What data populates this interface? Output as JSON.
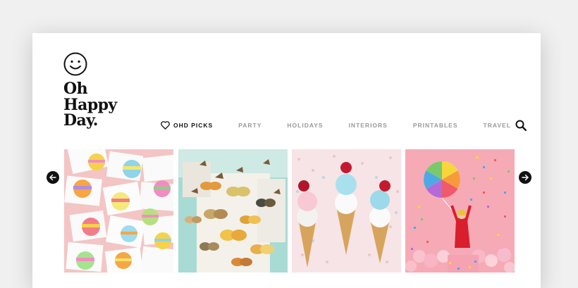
{
  "logo": {
    "icon": "smiley-icon",
    "lines": [
      "Oh",
      "Happy",
      "Day."
    ]
  },
  "nav": {
    "items": [
      {
        "label": "OHD PICKS",
        "icon": "heart-icon",
        "active": true
      },
      {
        "label": "PARTY"
      },
      {
        "label": "HOLIDAYS"
      },
      {
        "label": "INTERIORS"
      },
      {
        "label": "PRINTABLES"
      },
      {
        "label": "TRAVEL"
      }
    ],
    "search_icon": "search-icon"
  },
  "carousel": {
    "prev_icon": "arrow-left-icon",
    "next_icon": "arrow-right-icon",
    "tiles": [
      {
        "subject": "rainbow-circle-cards",
        "bg": "#f3c5c5"
      },
      {
        "subject": "paper-butterflies",
        "bg": "#a8dbd4"
      },
      {
        "subject": "honeycomb-ice-cream-cones",
        "bg": "#f7e4e6"
      },
      {
        "subject": "girl-with-rainbow-balloon",
        "bg": "#f6aab6"
      }
    ]
  },
  "colors": {
    "text": "#111111",
    "nav_inactive": "#9a9a9a",
    "page_bg": "#f0f0f0",
    "card_bg": "#ffffff"
  }
}
